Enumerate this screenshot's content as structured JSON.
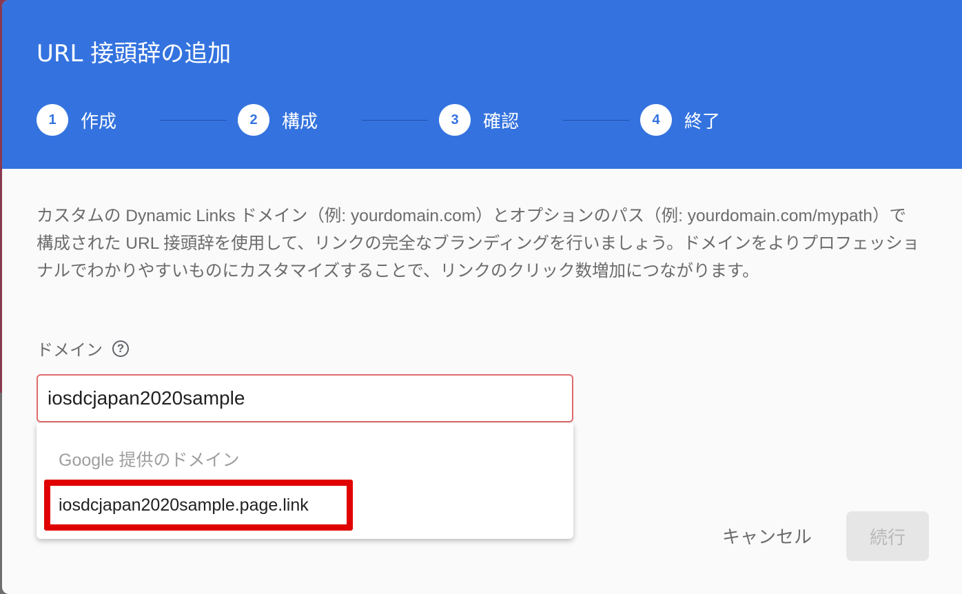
{
  "dialog": {
    "title": "URL 接頭辞の追加"
  },
  "stepper": {
    "steps": [
      {
        "number": "1",
        "label": "作成"
      },
      {
        "number": "2",
        "label": "構成"
      },
      {
        "number": "3",
        "label": "確認"
      },
      {
        "number": "4",
        "label": "終了"
      }
    ]
  },
  "description": "カスタムの Dynamic Links ドメイン（例: yourdomain.com）とオプションのパス（例: yourdomain.com/mypath）で構成された URL 接頭辞を使用して、リンクの完全なブランディングを行いましょう。ドメインをよりプロフェッショナルでわかりやすいものにカスタマイズすることで、リンクのクリック数増加につながります。",
  "domain_field": {
    "label": "ドメイン",
    "help_icon": "help-circle-icon",
    "value": "iosdcjapan2020sample"
  },
  "suggestions": {
    "header": "Google 提供のドメイン",
    "options": [
      "iosdcjapan2020sample.page.link"
    ]
  },
  "actions": {
    "cancel_label": "キャンセル",
    "continue_label": "続行"
  },
  "colors": {
    "header": "#3473df",
    "highlight": "#e00000",
    "input_error_border": "#e06a6a"
  }
}
